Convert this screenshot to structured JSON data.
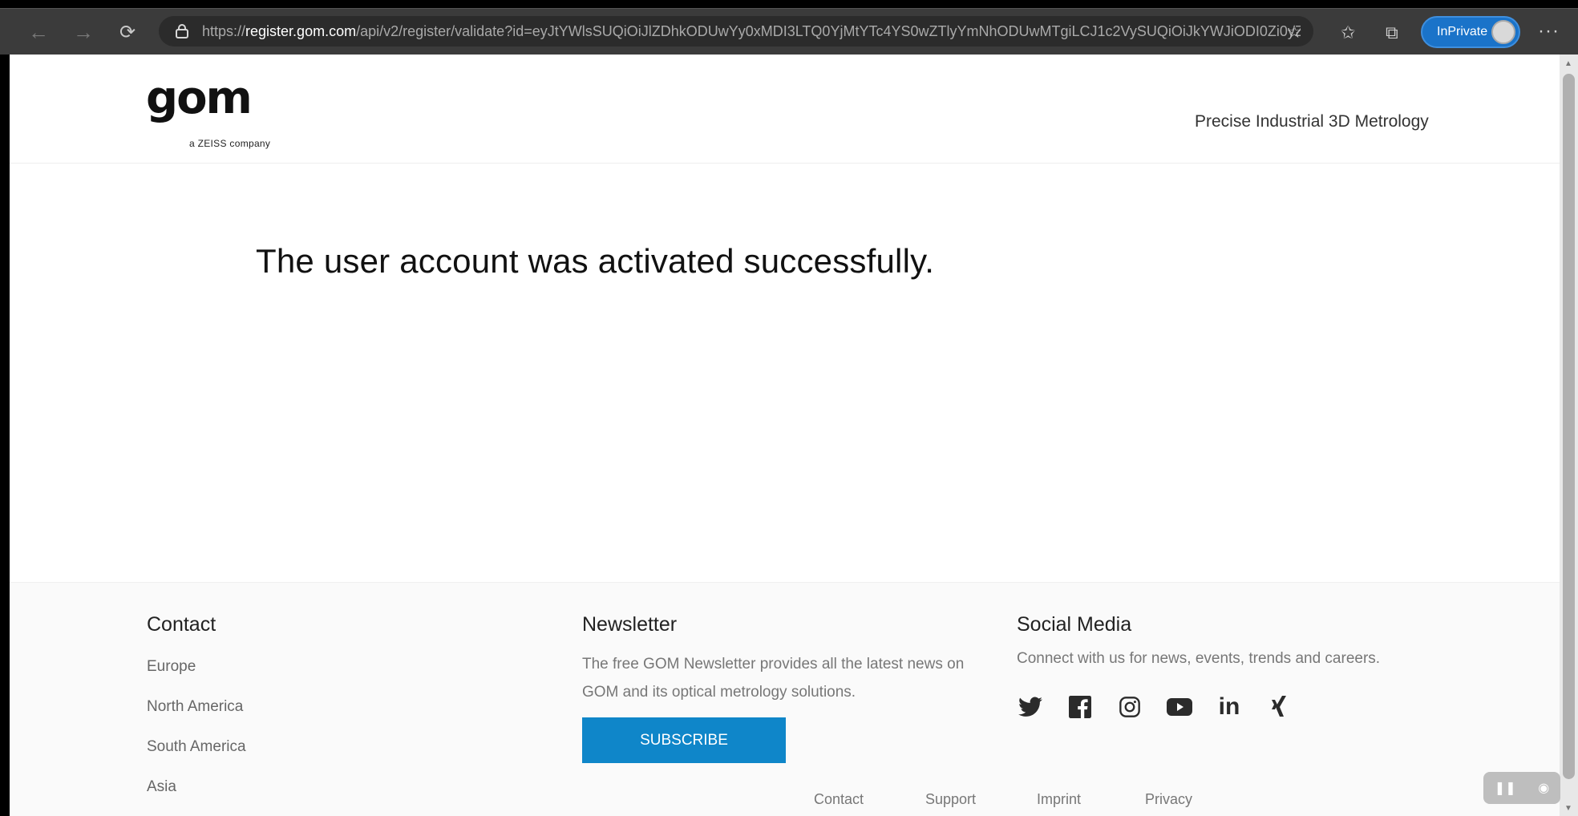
{
  "browser": {
    "url_prefix": "https://",
    "url_host": "register.gom.com",
    "url_rest": "/api/v2/register/validate?id=eyJtYWlsSUQiOiJlZDhkODUwYy0xMDI3LTQ0YjMtYTc4YS0wZTlyYmNhODUwMTgiLCJ1c2VySUQiOiJkYWJiODI0Zi0yZ...",
    "inprivate_label": "InPrivate",
    "more_label": "···"
  },
  "header": {
    "logo_text": "gom",
    "logo_sub": "a ZEISS company",
    "tagline": "Precise Industrial 3D Metrology"
  },
  "main": {
    "message": "The user account was activated successfully."
  },
  "footer": {
    "contact": {
      "title": "Contact",
      "links": [
        "Europe",
        "North America",
        "South America",
        "Asia"
      ]
    },
    "newsletter": {
      "title": "Newsletter",
      "text": "The free GOM Newsletter provides all the latest news on GOM and its optical metrology solutions.",
      "button": "SUBSCRIBE"
    },
    "social": {
      "title": "Social Media",
      "text": "Connect with us for news, events, trends and careers.",
      "icons": [
        "twitter-icon",
        "facebook-icon",
        "instagram-icon",
        "youtube-icon",
        "linkedin-icon",
        "xing-icon"
      ]
    },
    "bottom_links": [
      "Contact",
      "Support",
      "Imprint",
      "Privacy"
    ]
  },
  "colors": {
    "subscribe": "#0f86c9",
    "inprivate": "#1a73c9"
  }
}
